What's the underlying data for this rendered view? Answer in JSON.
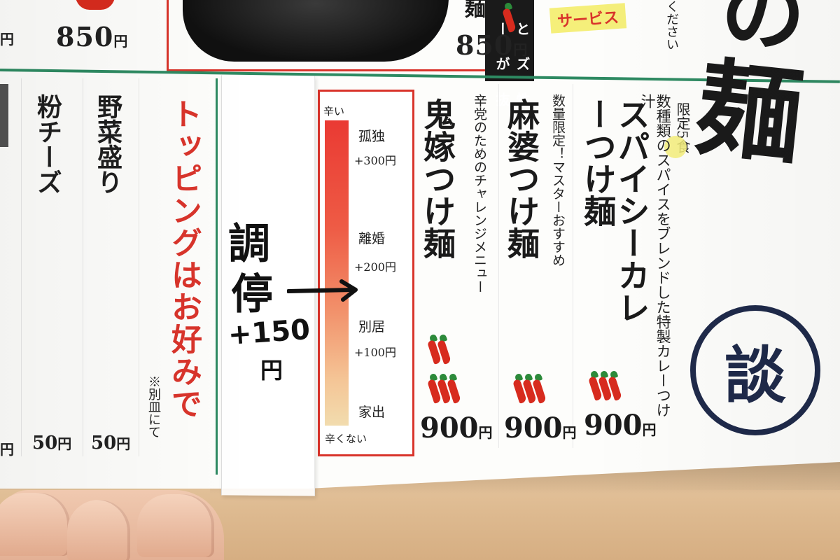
{
  "top_strip": {
    "col1_price": "850",
    "col2_price": "850",
    "yen": "円",
    "photo_caption": "ースとーズが性抜群",
    "item_fragment": "麺",
    "service_badge": "サービス",
    "note_fragment": "ください"
  },
  "big_kanji": {
    "header_char": "麺",
    "partial_char": "の",
    "seal_char": "談"
  },
  "left_items": [
    {
      "name": "粉チーズ",
      "price": "50"
    },
    {
      "name": "野菜盛り",
      "price": "50"
    }
  ],
  "topping_note": "トッピングはお好みで",
  "separate_plate": "※別皿にて",
  "tape_handwriting": {
    "word_line1": "調",
    "word_line2": "停",
    "price_line": "+150",
    "yen": "円"
  },
  "meter": {
    "top_label": "辛い",
    "bottom_label": "辛くない",
    "levels": [
      {
        "name": "孤独",
        "price": "+300円",
        "fill_fraction": 0.9
      },
      {
        "name": "離婚",
        "price": "+200円",
        "fill_fraction": 0.6
      },
      {
        "name": "別居",
        "price": "+100円",
        "fill_fraction": 0.33
      },
      {
        "name": "家出",
        "price": "",
        "fill_fraction": 0.08
      }
    ]
  },
  "menu_items": [
    {
      "name": "鬼嫁つけ麺",
      "description": "辛党のためのチャレンジメニュー",
      "price": "900",
      "chili_count": 5,
      "badge": ""
    },
    {
      "name": "麻婆つけ麺",
      "description": "数量限定！マスターおすすめ",
      "price": "900",
      "chili_count": 3,
      "badge": ""
    },
    {
      "name": "スパイシーカレーつけ麺",
      "description": "数種類のスパイスをブレンドした特製カレーつけ汁",
      "price": "900",
      "chili_count": 3,
      "badge": "限定5食"
    }
  ],
  "yen": "円",
  "colors": {
    "accent_red": "#d9342b",
    "rule_green": "#2e8a62",
    "seal_navy": "#1f2a4a",
    "badge_yellow": "#f5ef7a"
  }
}
